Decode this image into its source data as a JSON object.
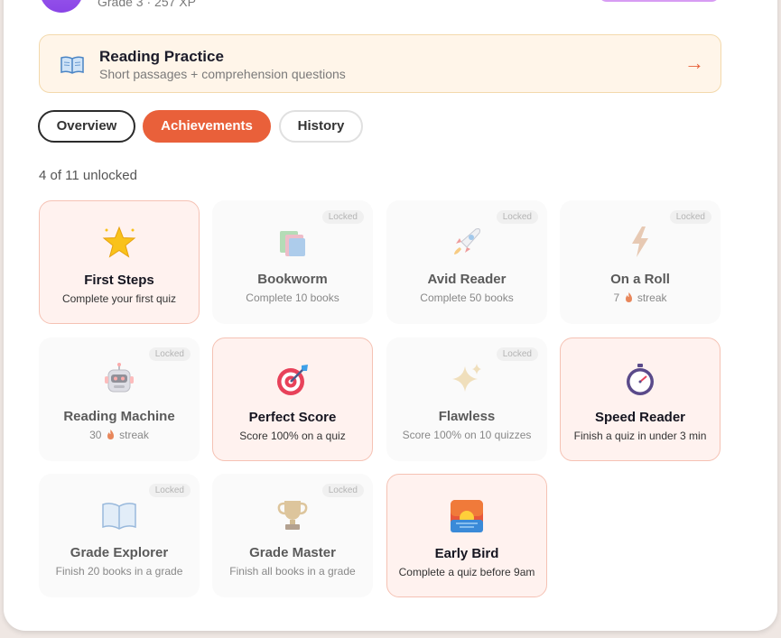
{
  "profile": {
    "subtitle": "Grade 3 · 257 XP"
  },
  "practice": {
    "title": "Reading Practice",
    "subtitle": "Short passages + comprehension questions",
    "arrow": "→",
    "icon": "open-book-icon"
  },
  "tabs": [
    {
      "label": "Overview",
      "active": false
    },
    {
      "label": "Achievements",
      "active": true
    },
    {
      "label": "History",
      "active": false
    }
  ],
  "unlock_count": "4 of 11 unlocked",
  "locked_label": "Locked",
  "achievements": [
    {
      "name": "First Steps",
      "desc": "Complete your first quiz",
      "icon": "glowing-star-icon",
      "unlocked": true
    },
    {
      "name": "Bookworm",
      "desc": "Complete 10 books",
      "icon": "books-icon",
      "unlocked": false
    },
    {
      "name": "Avid Reader",
      "desc": "Complete 50 books",
      "icon": "rocket-icon",
      "unlocked": false
    },
    {
      "name": "On a Roll",
      "desc_prefix": "7",
      "desc_suffix": "streak",
      "icon": "lightning-icon",
      "unlocked": false
    },
    {
      "name": "Reading Machine",
      "desc_prefix": "30",
      "desc_suffix": "streak",
      "icon": "robot-icon",
      "unlocked": false
    },
    {
      "name": "Perfect Score",
      "desc": "Score 100% on a quiz",
      "icon": "bullseye-icon",
      "unlocked": true
    },
    {
      "name": "Flawless",
      "desc": "Score 100% on 10 quizzes",
      "icon": "sparkles-icon",
      "unlocked": false
    },
    {
      "name": "Speed Reader",
      "desc": "Finish a quiz in under 3 min",
      "icon": "stopwatch-icon",
      "unlocked": true
    },
    {
      "name": "Grade Explorer",
      "desc": "Finish 20 books in a grade",
      "icon": "open-book-icon",
      "unlocked": false
    },
    {
      "name": "Grade Master",
      "desc": "Finish all books in a grade",
      "icon": "trophy-icon",
      "unlocked": false
    },
    {
      "name": "Early Bird",
      "desc": "Complete a quiz before 9am",
      "icon": "sunrise-icon",
      "unlocked": true
    }
  ],
  "colors": {
    "accent": "#e9603a",
    "unlocked_bg": "#fff2ef",
    "practice_bg": "#fff5e9"
  }
}
